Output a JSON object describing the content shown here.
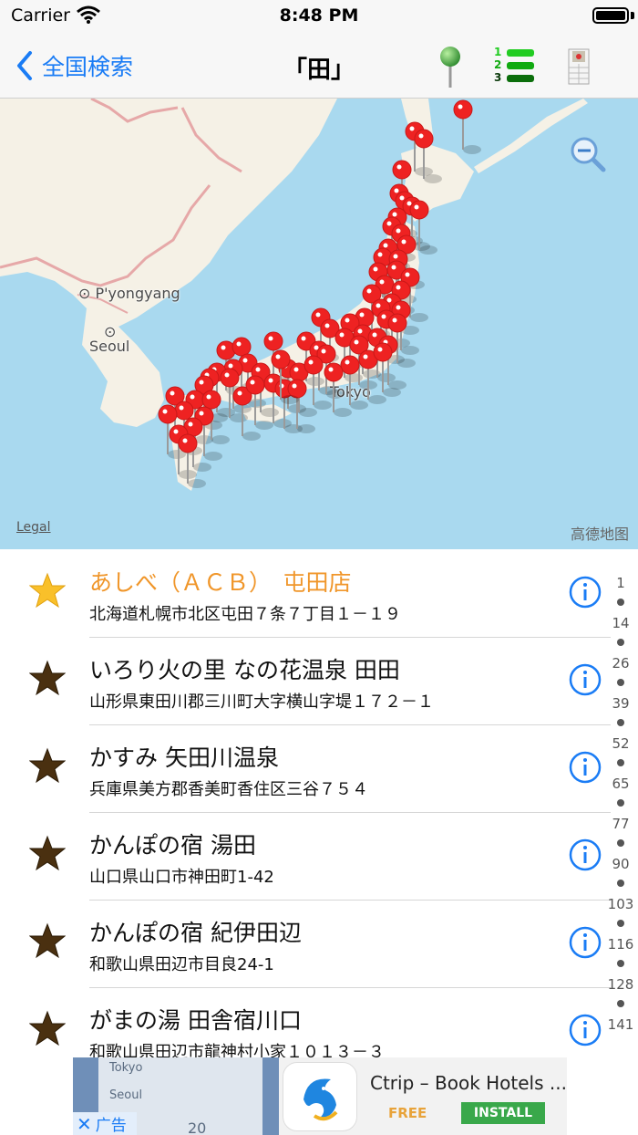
{
  "status": {
    "carrier": "Carrier",
    "time": "8:48 PM"
  },
  "nav": {
    "back_label": "全国検索",
    "title": "「田」",
    "rank_digits": [
      "1",
      "2",
      "3"
    ]
  },
  "map": {
    "labels": {
      "pyongyang": "P'yongyang",
      "seoul": "Seoul",
      "tokyo": "Tokyo"
    },
    "legal": "Legal",
    "provider": "高德地图"
  },
  "list": {
    "rows": [
      {
        "name": "あしべ（ＡＣＢ）　屯田店",
        "address": "北海道札幌市北区屯田７条７丁目１－１９",
        "featured": true
      },
      {
        "name": "いろり火の里 なの花温泉 田田",
        "address": "山形県東田川郡三川町大字横山字堤１７２－１",
        "featured": false
      },
      {
        "name": "かすみ 矢田川温泉",
        "address": "兵庫県美方郡香美町香住区三谷７５４",
        "featured": false
      },
      {
        "name": "かんぽの宿 湯田",
        "address": "山口県山口市神田町1-42",
        "featured": false
      },
      {
        "name": "かんぽの宿 紀伊田辺",
        "address": "和歌山県田辺市目良24-1",
        "featured": false
      },
      {
        "name": "がまの湯 田舎宿川口",
        "address": "和歌山県田辺市龍神村小家１０１３－３",
        "featured": false
      }
    ]
  },
  "index": [
    "1",
    "14",
    "26",
    "39",
    "52",
    "65",
    "77",
    "90",
    "103",
    "116",
    "128",
    "141"
  ],
  "ad": {
    "thumb_lines": [
      "Tokyo",
      "Seoul",
      "20"
    ],
    "close_label": "广告",
    "title": "Ctrip – Book Hotels ...",
    "price": "FREE",
    "install": "INSTALL"
  },
  "colors": {
    "accent": "#1a7cf5",
    "featured": "#f0962a",
    "pin": "#ee2222",
    "water": "#a9d9ef",
    "land": "#f5f1e6"
  }
}
